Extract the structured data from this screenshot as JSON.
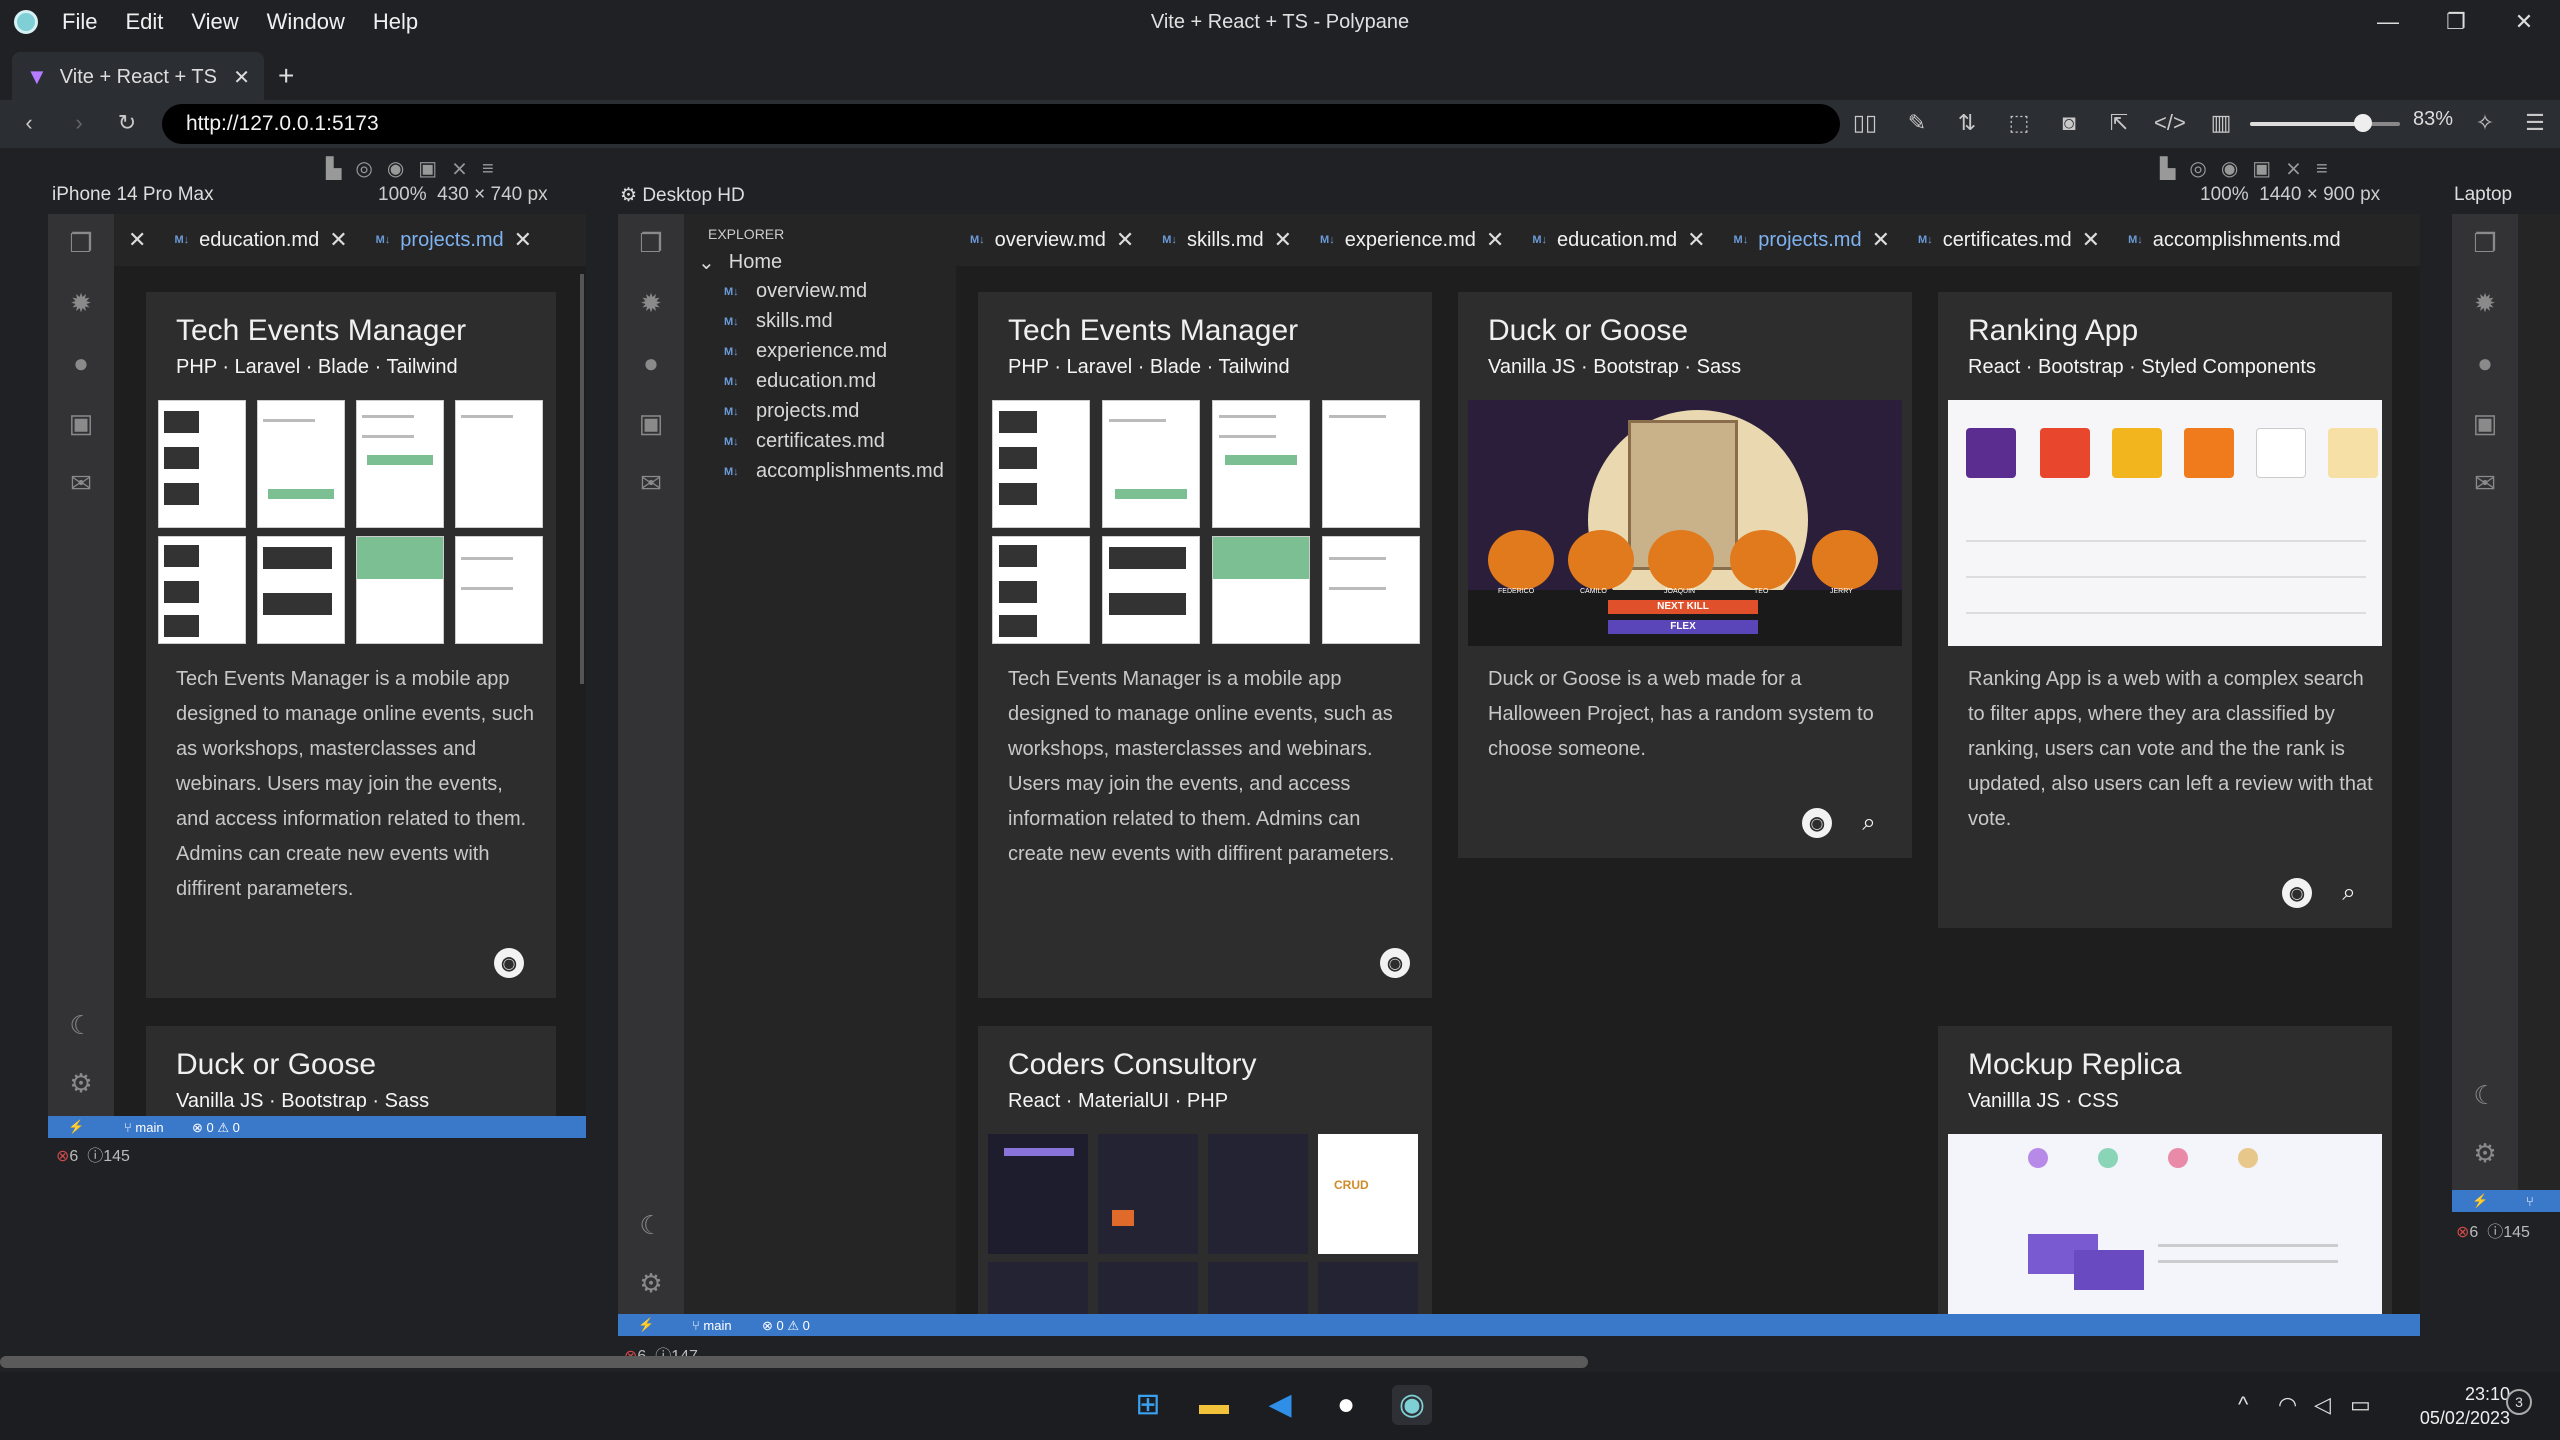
{
  "app": {
    "menus": [
      "File",
      "Edit",
      "View",
      "Window",
      "Help"
    ],
    "window_title": "Vite + React + TS - Polypane"
  },
  "browser": {
    "tab_title": "Vite + React + TS",
    "url": "http://127.0.0.1:5173",
    "zoom": "83%",
    "zoom_fraction": 0.75
  },
  "panes": {
    "phone": {
      "label": "iPhone 14 Pro Max",
      "scale": "100%",
      "size": "430 × 740 px"
    },
    "desktop": {
      "label": "Desktop HD",
      "scale": "100%",
      "size": "1440 × 900 px"
    },
    "laptop": {
      "label": "Laptop"
    }
  },
  "editor": {
    "tabs": [
      "overview.md",
      "skills.md",
      "experience.md",
      "education.md",
      "projects.md",
      "certificates.md",
      "accomplishments.md"
    ],
    "phone_tabs": [
      "education.md",
      "projects.md"
    ],
    "active_tab": "projects.md",
    "explorer": {
      "title": "EXPLORER",
      "folder": "Home",
      "files": [
        "overview.md",
        "skills.md",
        "experience.md",
        "education.md",
        "projects.md",
        "certificates.md",
        "accomplishments.md"
      ]
    },
    "file_badge": "M↓"
  },
  "projects": [
    {
      "title": "Tech Events Manager",
      "tech": "PHP · Laravel · Blade · Tailwind",
      "desc": "Tech Events Manager is a mobile app designed to manage online events, such as workshops, masterclasses and webinars. Users may join the events, and access information related to them. Admins can create new events with diffirent parameters."
    },
    {
      "title": "Duck or Goose",
      "tech": "Vanilla JS · Bootstrap · Sass",
      "desc": "Duck or Goose is a web made for a Halloween Project, has a random system to choose someone."
    },
    {
      "title": "Ranking App",
      "tech": "React · Bootstrap · Styled Components",
      "desc": "Ranking App is a web with a complex search to filter apps, where they ara classified by ranking, users can vote and the the rank is updated, also users can left a review with that vote."
    },
    {
      "title": "Coders Consultory",
      "tech": "React · MaterialUI · PHP"
    },
    {
      "title": "Mockup Replica",
      "tech": "Vanillla JS · CSS"
    }
  ],
  "status": {
    "branch": "main",
    "errors": "0",
    "warnings": "0",
    "err_count_phone": "6",
    "info_count_phone": "145",
    "err_count_desktop": "6",
    "info_count_desktop": "147",
    "err_count_laptop": "6",
    "info_count_laptop": "145"
  },
  "screenshot_text": {
    "duck_next": "NEXT KILL",
    "duck_flex": "FLEX",
    "duck_names": [
      "FEDERICO",
      "CAMILO",
      "JOAQUIN",
      "TEO",
      "JERRY"
    ],
    "coders_crud": "CRUD"
  },
  "taskbar": {
    "time": "23:10",
    "date": "05/02/2023",
    "notifications": "3"
  },
  "colors": {
    "status_bar": "#3a78c9",
    "active_tab_text": "#7fb2f0",
    "card_bg": "#2d2d2d",
    "editor_bg": "#1e1e1e"
  }
}
